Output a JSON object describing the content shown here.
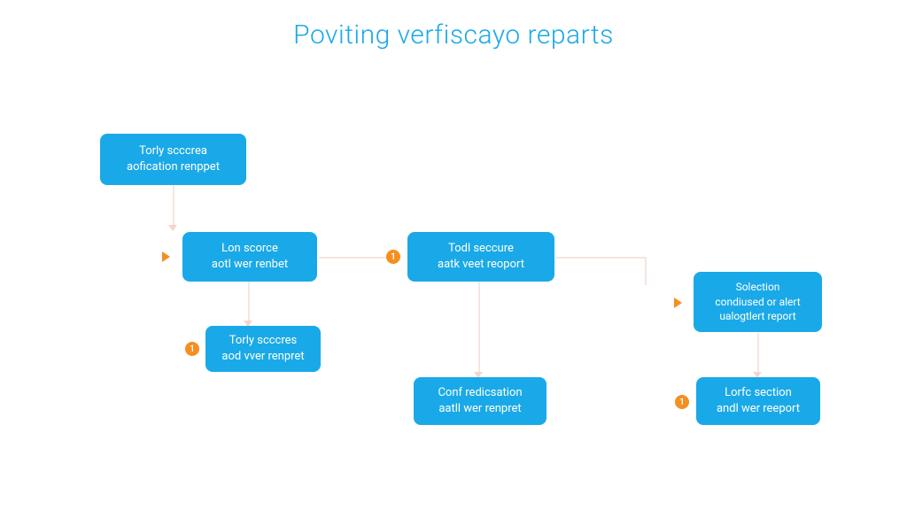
{
  "title": "Poviting verfiscayo reparts",
  "nodes": {
    "n1": {
      "line1": "Torly scccrea",
      "line2": "aofication renppet"
    },
    "n2": {
      "line1": "Lon scorce",
      "line2": "aotl wer renbet"
    },
    "n3": {
      "line1": "Torly scccres",
      "line2": "aod vver renpret"
    },
    "n4": {
      "line1": "Todl seccure",
      "line2": "aatk veet reoport"
    },
    "n5": {
      "line1": "Conf redicsation",
      "line2": "aatll wer renpret"
    },
    "n6": {
      "line1": "Solection",
      "line2": "condiused or alert",
      "line3": "ualogtlert report"
    },
    "n7": {
      "line1": "Lorfc section",
      "line2": "andl wer reeport"
    }
  },
  "badges": {
    "b1": "1",
    "b2": "1",
    "b3": "1"
  }
}
